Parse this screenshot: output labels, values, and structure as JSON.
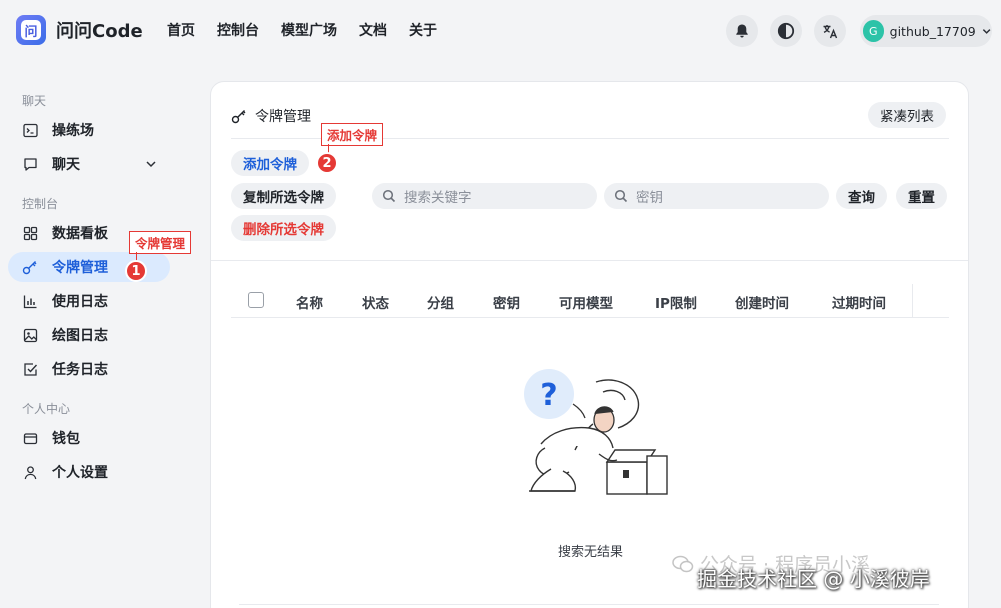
{
  "header": {
    "brand": "问问Code",
    "logo_glyph": "问",
    "nav": [
      "首页",
      "控制台",
      "模型广场",
      "文档",
      "关于"
    ],
    "icons": [
      "bell-icon",
      "moon-icon",
      "translate-icon"
    ],
    "user": {
      "avatar_letter": "G",
      "name": "github_17709"
    }
  },
  "sidebar": {
    "groups": [
      {
        "title": "聊天",
        "items": [
          {
            "label": "操练场",
            "icon": "terminal-icon"
          },
          {
            "label": "聊天",
            "icon": "chat-icon"
          }
        ]
      },
      {
        "title": "控制台",
        "items": [
          {
            "label": "数据看板",
            "icon": "dashboard-icon"
          },
          {
            "label": "令牌管理",
            "icon": "key-icon",
            "active": true
          },
          {
            "label": "使用日志",
            "icon": "bar-chart-icon"
          },
          {
            "label": "绘图日志",
            "icon": "image-icon"
          },
          {
            "label": "任务日志",
            "icon": "task-icon"
          }
        ]
      },
      {
        "title": "个人中心",
        "items": [
          {
            "label": "钱包",
            "icon": "wallet-icon"
          },
          {
            "label": "个人设置",
            "icon": "user-icon"
          }
        ]
      }
    ]
  },
  "annotations": {
    "callout1": {
      "text": "令牌管理",
      "badge": "1"
    },
    "callout2": {
      "text": "添加令牌",
      "badge": "2"
    },
    "color": "#e53935"
  },
  "card": {
    "title": "令牌管理",
    "compact_button": "紧凑列表",
    "add_button": "添加令牌",
    "copy_button": "复制所选令牌",
    "delete_button": "删除所选令牌",
    "search_keyword_placeholder": "搜索关键字",
    "search_key_placeholder": "密钥",
    "query_button": "查询",
    "reset_button": "重置",
    "columns": [
      "名称",
      "状态",
      "分组",
      "密钥",
      "可用模型",
      "IP限制",
      "创建时间",
      "过期时间"
    ],
    "empty_text": "搜索无结果"
  },
  "watermark": {
    "line1": "公众号 · 程序员小溪",
    "line2": "掘金技术社区 @ 小溪彼岸"
  },
  "colors": {
    "accent": "#1e5fd9",
    "danger": "#e53935",
    "active_bg": "#dbeafe"
  }
}
